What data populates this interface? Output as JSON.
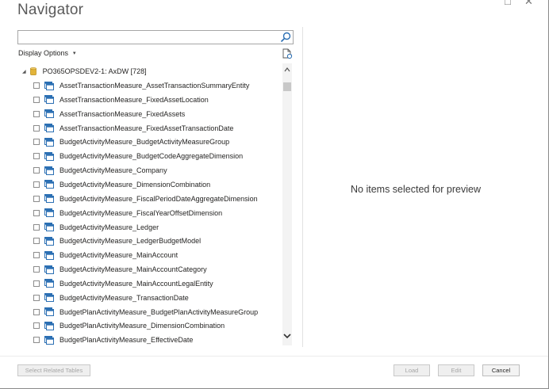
{
  "window": {
    "title": "Navigator",
    "controls": {
      "maximize": "□",
      "close": "✕"
    }
  },
  "search": {
    "value": "",
    "placeholder": ""
  },
  "display_options": {
    "label": "Display Options",
    "caret": "▾"
  },
  "tree": {
    "root_label": "PO365OPSDEV2-1: AxDW [728]",
    "items": [
      "AssetTransactionMeasure_AssetTransactionSummaryEntity",
      "AssetTransactionMeasure_FixedAssetLocation",
      "AssetTransactionMeasure_FixedAssets",
      "AssetTransactionMeasure_FixedAssetTransactionDate",
      "BudgetActivityMeasure_BudgetActivityMeasureGroup",
      "BudgetActivityMeasure_BudgetCodeAggregateDimension",
      "BudgetActivityMeasure_Company",
      "BudgetActivityMeasure_DimensionCombination",
      "BudgetActivityMeasure_FiscalPeriodDateAggregateDimension",
      "BudgetActivityMeasure_FiscalYearOffsetDimension",
      "BudgetActivityMeasure_Ledger",
      "BudgetActivityMeasure_LedgerBudgetModel",
      "BudgetActivityMeasure_MainAccount",
      "BudgetActivityMeasure_MainAccountCategory",
      "BudgetActivityMeasure_MainAccountLegalEntity",
      "BudgetActivityMeasure_TransactionDate",
      "BudgetPlanActivityMeasure_BudgetPlanActivityMeasureGroup",
      "BudgetPlanActivityMeasure_DimensionCombination",
      "BudgetPlanActivityMeasure_EffectiveDate"
    ]
  },
  "preview": {
    "message": "No items selected for preview"
  },
  "footer": {
    "select_related": "Select Related Tables",
    "load": "Load",
    "edit": "Edit",
    "cancel": "Cancel"
  },
  "colors": {
    "accent_blue": "#2b6fb3",
    "db_gold": "#d8a71e",
    "border": "#a6a6a6"
  }
}
